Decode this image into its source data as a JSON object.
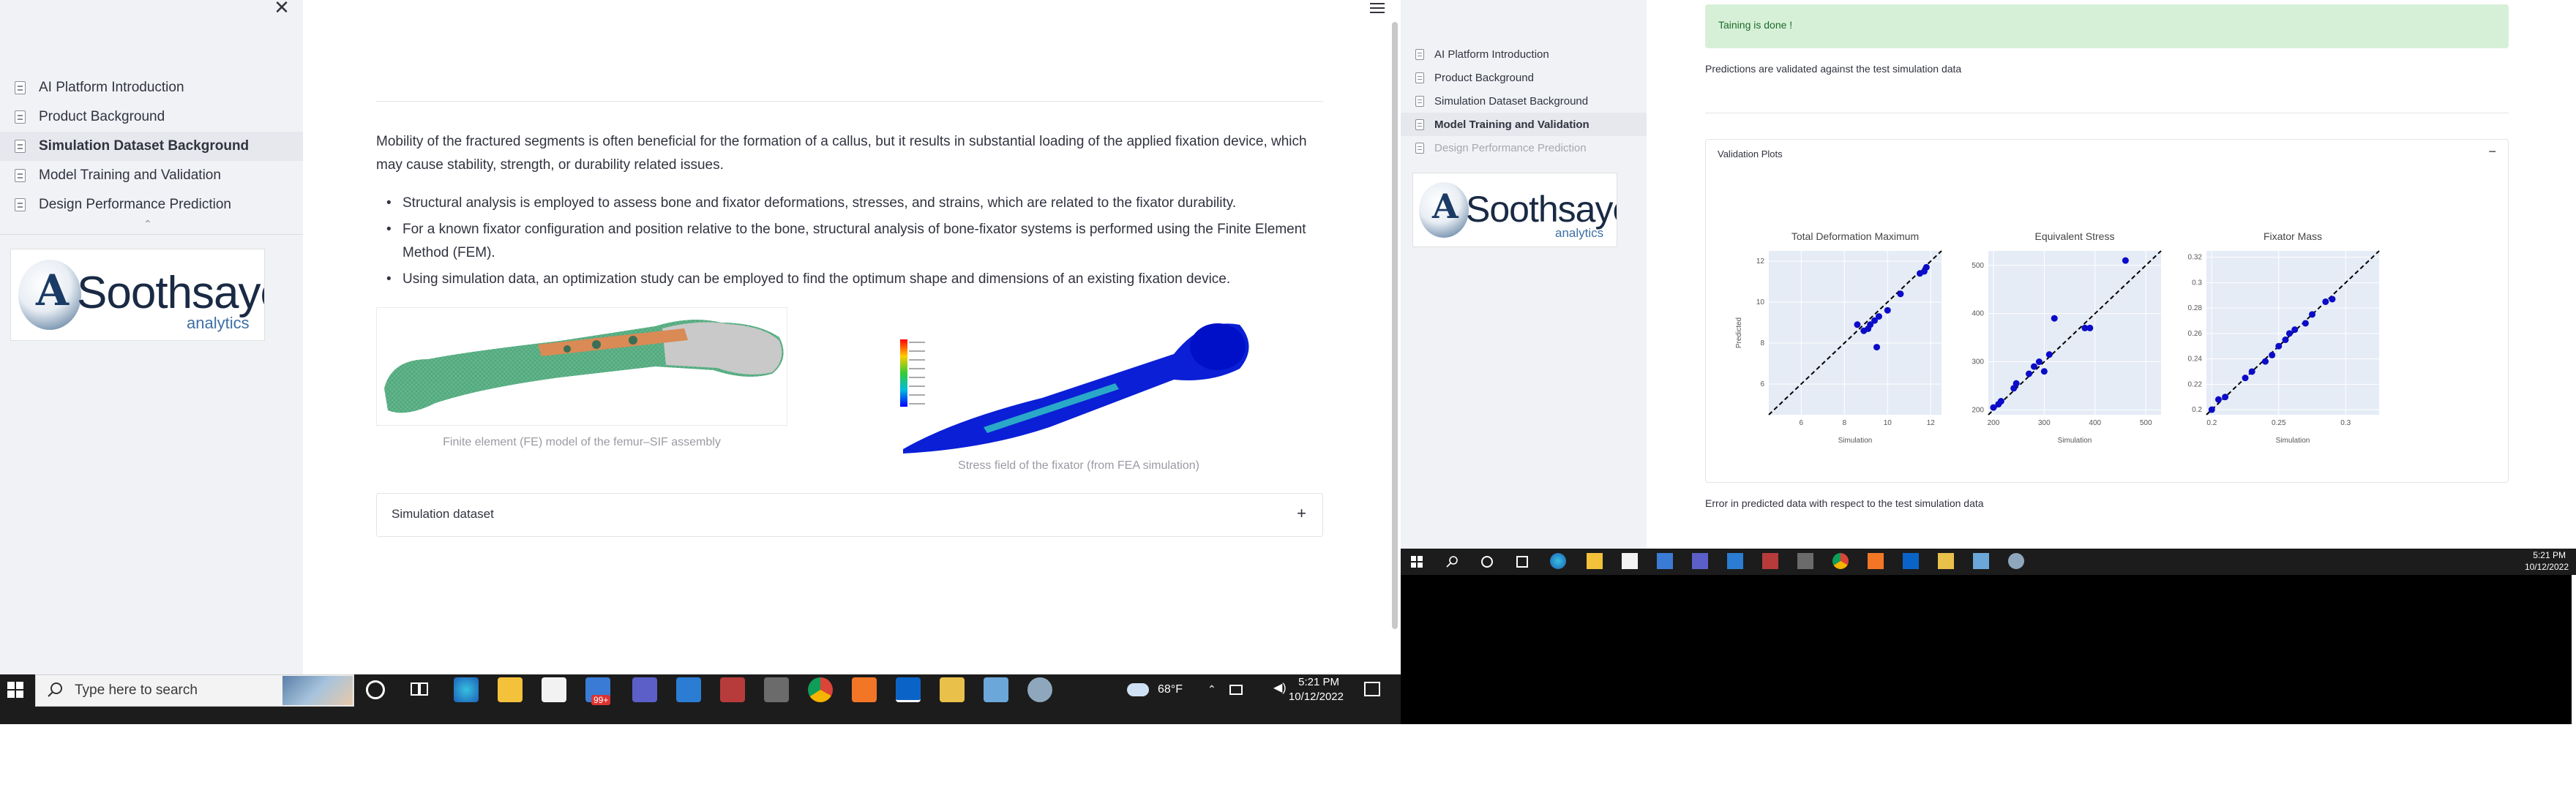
{
  "left": {
    "sidebar": {
      "items": [
        {
          "label": "AI Platform Introduction",
          "active": false
        },
        {
          "label": "Product Background",
          "active": false
        },
        {
          "label": "Simulation Dataset Background",
          "active": true
        },
        {
          "label": "Model Training and Validation",
          "active": false
        },
        {
          "label": "Design Performance Prediction",
          "active": false
        }
      ],
      "close_glyph": "✕",
      "chevron_glyph": "⌃"
    },
    "logo": {
      "word": "Soothsayer",
      "sub": "analytics",
      "letter": "A"
    },
    "main": {
      "intro": "Mobility of the fractured segments is often beneficial for the formation of a callus, but it results in substantial loading of the applied fixation device, which may cause stability, strength, or durability related issues.",
      "bullets": [
        "Structural analysis is employed to assess bone and fixator deformations, stresses, and strains, which are related to the fixator durability.",
        "For a known fixator configuration and position relative to the bone, structural analysis of bone-fixator systems is performed using the Finite Element Method (FEM).",
        "Using simulation data, an optimization study can be employed to find the optimum shape and dimensions of an existing fixation device."
      ],
      "caption_fe": "Finite element (FE) model of the femur–SIF assembly",
      "caption_stress": "Stress field of the fixator (from FEA simulation)",
      "expander_label": "Simulation dataset",
      "expander_glyph": "+"
    },
    "taskbar": {
      "search_placeholder": "Type here to search",
      "weather": "68°F",
      "time": "5:21 PM",
      "date": "10/12/2022",
      "badge": "99+"
    }
  },
  "right": {
    "sidebar": {
      "items": [
        {
          "label": "AI Platform Introduction"
        },
        {
          "label": "Product Background"
        },
        {
          "label": "Simulation Dataset Background"
        },
        {
          "label": "Model Training and Validation"
        },
        {
          "label": "Design Performance Prediction"
        }
      ]
    },
    "main": {
      "success": "Taining is done !",
      "validated_text": "Predictions are validated against the test simulation data",
      "plots_header": "Validation Plots",
      "collapse_glyph": "−",
      "error_text": "Error in predicted data with respect to the test simulation data"
    },
    "taskbar": {
      "time": "5:21 PM",
      "date": "10/12/2022"
    }
  },
  "chart_data": [
    {
      "type": "scatter",
      "title": "Total Deformation Maximum",
      "xlabel": "Simulation",
      "ylabel": "Predicted",
      "xlim": [
        4.5,
        12.5
      ],
      "ylim": [
        4.5,
        12.5
      ],
      "xticks": [
        "6",
        "8",
        "10",
        "12"
      ],
      "yticks": [
        "6",
        "8",
        "10",
        "12"
      ],
      "identity_line": true,
      "points": [
        [
          8.6,
          8.9
        ],
        [
          8.9,
          8.6
        ],
        [
          9.2,
          8.9
        ],
        [
          9.4,
          9.1
        ],
        [
          9.6,
          9.3
        ],
        [
          9.5,
          7.8
        ],
        [
          10.0,
          9.6
        ],
        [
          10.6,
          10.4
        ],
        [
          11.5,
          11.4
        ],
        [
          11.7,
          11.5
        ],
        [
          11.8,
          11.7
        ],
        [
          9.1,
          8.7
        ]
      ]
    },
    {
      "type": "scatter",
      "title": "Equivalent Stress",
      "xlabel": "Simulation",
      "ylabel": "",
      "xlim": [
        190,
        530
      ],
      "ylim": [
        190,
        530
      ],
      "xticks": [
        "200",
        "300",
        "400",
        "500"
      ],
      "yticks": [
        "200",
        "300",
        "400",
        "500"
      ],
      "identity_line": true,
      "points": [
        [
          200,
          205
        ],
        [
          210,
          212
        ],
        [
          215,
          218
        ],
        [
          240,
          245
        ],
        [
          245,
          255
        ],
        [
          270,
          275
        ],
        [
          280,
          290
        ],
        [
          290,
          300
        ],
        [
          310,
          315
        ],
        [
          380,
          370
        ],
        [
          390,
          370
        ],
        [
          320,
          390
        ],
        [
          460,
          510
        ],
        [
          300,
          280
        ]
      ]
    },
    {
      "type": "scatter",
      "title": "Fixator Mass",
      "xlabel": "Simulation",
      "ylabel": "",
      "xlim": [
        0.196,
        0.325
      ],
      "ylim": [
        0.196,
        0.325
      ],
      "xticks": [
        "0.2",
        "0.25",
        "0.3"
      ],
      "yticks": [
        "0.2",
        "0.22",
        "0.24",
        "0.26",
        "0.28",
        "0.3",
        "0.32"
      ],
      "identity_line": true,
      "points": [
        [
          0.2,
          0.2
        ],
        [
          0.205,
          0.208
        ],
        [
          0.21,
          0.21
        ],
        [
          0.225,
          0.225
        ],
        [
          0.23,
          0.23
        ],
        [
          0.24,
          0.238
        ],
        [
          0.245,
          0.243
        ],
        [
          0.25,
          0.25
        ],
        [
          0.255,
          0.255
        ],
        [
          0.258,
          0.26
        ],
        [
          0.262,
          0.263
        ],
        [
          0.27,
          0.268
        ],
        [
          0.275,
          0.275
        ],
        [
          0.285,
          0.285
        ],
        [
          0.29,
          0.287
        ]
      ]
    }
  ]
}
